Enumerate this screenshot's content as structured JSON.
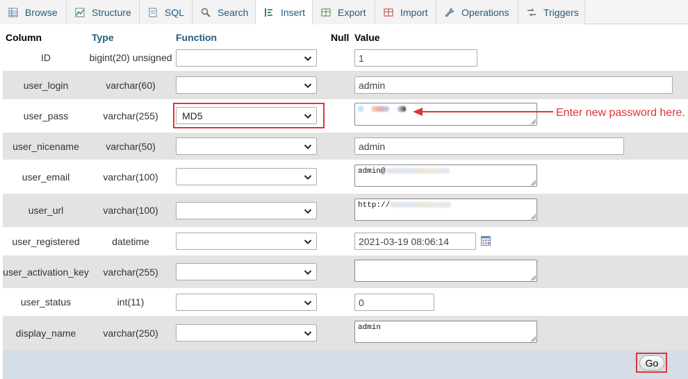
{
  "tabs": [
    {
      "label": "Browse",
      "icon": "browse-icon"
    },
    {
      "label": "Structure",
      "icon": "structure-icon"
    },
    {
      "label": "SQL",
      "icon": "sql-icon"
    },
    {
      "label": "Search",
      "icon": "search-icon"
    },
    {
      "label": "Insert",
      "icon": "insert-icon",
      "active": true
    },
    {
      "label": "Export",
      "icon": "export-icon"
    },
    {
      "label": "Import",
      "icon": "import-icon"
    },
    {
      "label": "Operations",
      "icon": "wrench-icon"
    },
    {
      "label": "Triggers",
      "icon": "triggers-icon"
    }
  ],
  "table_header": {
    "column": "Column",
    "type": "Type",
    "function": "Function",
    "null": "Null",
    "value": "Value"
  },
  "rows": [
    {
      "column": "ID",
      "type": "bigint(20) unsigned",
      "function": "",
      "value": "1"
    },
    {
      "column": "user_login",
      "type": "varchar(60)",
      "function": "",
      "value": "admin"
    },
    {
      "column": "user_pass",
      "type": "varchar(255)",
      "function": "MD5",
      "value": ""
    },
    {
      "column": "user_nicename",
      "type": "varchar(50)",
      "function": "",
      "value": "admin"
    },
    {
      "column": "user_email",
      "type": "varchar(100)",
      "function": "",
      "value": "admin@"
    },
    {
      "column": "user_url",
      "type": "varchar(100)",
      "function": "",
      "value": "http://"
    },
    {
      "column": "user_registered",
      "type": "datetime",
      "function": "",
      "value": "2021-03-19 08:06:14"
    },
    {
      "column": "user_activation_key",
      "type": "varchar(255)",
      "function": "",
      "value": ""
    },
    {
      "column": "user_status",
      "type": "int(11)",
      "function": "",
      "value": "0"
    },
    {
      "column": "display_name",
      "type": "varchar(250)",
      "function": "",
      "value": "admin"
    }
  ],
  "annotation": "Enter new password here.",
  "go_label": "Go",
  "colors": {
    "tab_text": "#235a81",
    "row_alt": "#e3e3e3",
    "highlight_red": "#e0323a",
    "footer": "#d5dee8"
  }
}
